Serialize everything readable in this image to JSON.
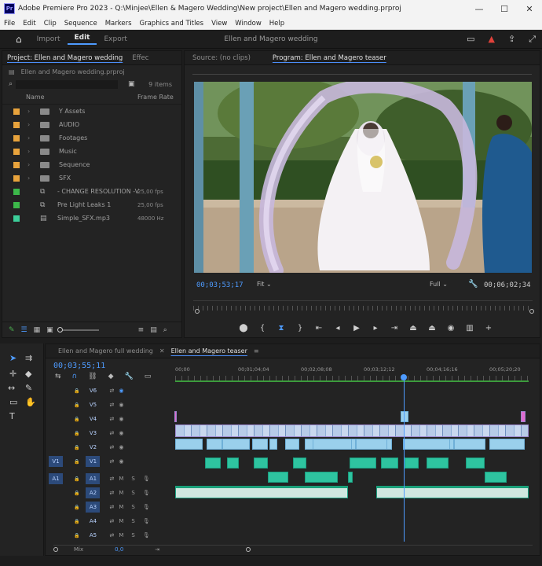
{
  "window": {
    "app_logo": "Pr",
    "title": "Adobe Premiere Pro 2023 - Q:\\Minjee\\Ellen & Magero Wedding\\New project\\Ellen and Magero wedding.prproj",
    "minimize": "—",
    "maximize": "☐",
    "close": "✕"
  },
  "menu": [
    "File",
    "Edit",
    "Clip",
    "Sequence",
    "Markers",
    "Graphics and Titles",
    "View",
    "Window",
    "Help"
  ],
  "header": {
    "tabs": [
      "Import",
      "Edit",
      "Export"
    ],
    "active_tab": "Edit",
    "project_title": "Ellen and Magero wedding",
    "icons": [
      "home-icon",
      "workspaces-icon",
      "alert-icon",
      "share-icon",
      "fullscreen-icon"
    ]
  },
  "project_panel": {
    "tabs": [
      "Project: Ellen and Magero wedding",
      "Effec"
    ],
    "file_name": "Ellen and Magero wedding.prproj",
    "items_count": "9 items",
    "col_name": "Name",
    "col_framerate": "Frame Rate",
    "items": [
      {
        "name": "Y Assets",
        "type": "folder",
        "color": "#e8a33c",
        "rate": ""
      },
      {
        "name": "AUDIO",
        "type": "folder",
        "color": "#e8a33c",
        "rate": ""
      },
      {
        "name": "Footages",
        "type": "folder",
        "color": "#e8a33c",
        "rate": ""
      },
      {
        "name": "Music",
        "type": "folder",
        "color": "#e8a33c",
        "rate": ""
      },
      {
        "name": "Sequence",
        "type": "folder",
        "color": "#e8a33c",
        "rate": ""
      },
      {
        "name": "SFX",
        "type": "folder",
        "color": "#e8a33c",
        "rate": ""
      },
      {
        "name": "- CHANGE RESOLUTION -V",
        "type": "sequence",
        "color": "#3cb84a",
        "rate": "25,00 fps"
      },
      {
        "name": "Pre Light Leaks 1",
        "type": "sequence",
        "color": "#3cb84a",
        "rate": "25,00 fps"
      },
      {
        "name": "Simple_SFX.mp3",
        "type": "audio",
        "color": "#3ccf9a",
        "rate": "48000 Hz"
      }
    ]
  },
  "source_tab": "Source: (no clips)",
  "program": {
    "tab": "Program: Ellen and Magero teaser",
    "timecode_left": "00;03;53;17",
    "fit": "Fit",
    "quality": "Full",
    "timecode_right": "00;06;02;34"
  },
  "timeline": {
    "tabs": [
      "Ellen and Magero full wedding",
      "Ellen and Magero teaser"
    ],
    "active_tab": "Ellen and Magero teaser",
    "timecode": "00;03;55;11",
    "ruler": [
      "00;00",
      "00;01;04;04",
      "00;02;08;08",
      "00;03;12;12",
      "00;04;16;16",
      "00;05;20;20"
    ],
    "video_tracks": [
      "V6",
      "V5",
      "V4",
      "V3",
      "V2",
      "V1"
    ],
    "audio_tracks": [
      "A1",
      "A2",
      "A3",
      "A4",
      "A5"
    ],
    "mix_label": "Mix",
    "mix_value": "0,0",
    "source_v": "V1",
    "source_a": "A1",
    "m": "M",
    "s": "S"
  },
  "colors": {
    "accent": "#4e9bff",
    "video_clip": "#9ad0ec",
    "audio_clip": "#2ec4a0",
    "label_clip": "#c9b8e8",
    "playhead": "#4e9bff"
  }
}
